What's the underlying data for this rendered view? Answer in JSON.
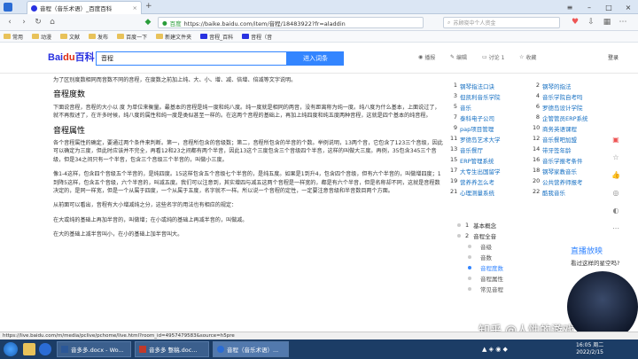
{
  "browser": {
    "tab_title": "音程（音乐术语）_百度百科",
    "new_tab": "+",
    "url": "https://baike.baidu.com/item/音程/18483922?fr=aladdin",
    "secure_label": "百度",
    "search_placeholder": "苏顾晓中个人资金",
    "bookmarks": [
      "常用",
      "动漫",
      "文献",
      "发布",
      "百度一下",
      "新建文件夹",
      "音程_百科",
      "音程（音"
    ]
  },
  "baike": {
    "logo_main": "Bai",
    "logo_mid": "du",
    "logo_suffix": "百科",
    "search_value": "音程",
    "search_button": "进入词条",
    "header_actions": [
      "播报",
      "编辑",
      "讨论 1",
      "收藏",
      "登录"
    ]
  },
  "article": {
    "intro": "为了区别度数相同而音数不同的音程，在度数之前加上纯、大、小、增、减、倍增、倍减等文字说明。",
    "sections": [
      {
        "title": "音程度数",
        "paragraphs": [
          "下面说音程，音程的大小以 度 为单位来衡量。最基本的音程是纯一度和纯八度。纯一度就是相同的两音，没有距离称为纯一度。纯八度为什么基本，上面说过了，就不再叙述了，在许多时候，纯八度的属性和纯一度是类似甚至一样的。在这两个音程的基础上，再加上纯四度和纯五度两种音程，这就是四个基本的纯音程。"
        ]
      },
      {
        "title": "音程属性",
        "paragraphs": [
          "各个音程属性的确定，要通过两个条件来判断。第一，音程所包含的音级数；第二，音程所包含的半音的个数。举例说明，13两个音，它包含了123三个音级，因此可以确定为三度，但此时应该并不完全，再看12和23之间都有两个半音，因此13这个三度包含三个音级四个半音，这样的叫做大三度。再例，35包含345三个音级，但是34之间只有一个半音，包含三个音级三个半音的，叫做小三度。",
          "像1-4这样，包含四个音级五个半音的，是纯四度。15这样包含五个音级七个半音的，是纯五度。如果是1到升4，包含四个音级，但有六个半音的，叫做增四度；1到降5这样，包含五个音级，六个半音的，叫减五度。我们可以注意到，其实增四与减五这两个音程是一样宽的，都是有六个半音，但是名称却不同，这就是音程数决定的，是同一样宽，但是一个从属于四度，一个从属于五度，名字就不一样。所以说一个音程的定性，一定要注意音级和半音数目两个方面。",
          "从前面可以看出，音程有大小增减纯之分，这些名字的用法也有相应的规定：",
          "在大或纯的基础上再加半音的，叫做增；在小或纯的基础上再减半音的，叫做减。",
          "在大的基础上减半音叫小，在小的基础上加半音叫大。"
        ]
      }
    ]
  },
  "sidebar": {
    "related": [
      {
        "n": "1",
        "t": "钢琴指法口诀"
      },
      {
        "n": "2",
        "t": "钢琴的指法"
      },
      {
        "n": "3",
        "t": "但凯利音乐学院"
      },
      {
        "n": "4",
        "t": "音乐学院自考吗"
      },
      {
        "n": "5",
        "t": "音乐"
      },
      {
        "n": "6",
        "t": "罗德岛设计学院"
      },
      {
        "n": "7",
        "t": "泰科电子公司"
      },
      {
        "n": "8",
        "t": "企管管员ERP系统"
      },
      {
        "n": "9",
        "t": "pap项目管理"
      },
      {
        "n": "10",
        "t": "商务英语课程"
      },
      {
        "n": "11",
        "t": "罗德岛艺术大学"
      },
      {
        "n": "12",
        "t": "音乐餐吧加盟"
      },
      {
        "n": "13",
        "t": "音乐餐厅"
      },
      {
        "n": "14",
        "t": "带牙签年龄"
      },
      {
        "n": "15",
        "t": "ERP管理系统"
      },
      {
        "n": "16",
        "t": "音乐学报考条件"
      },
      {
        "n": "17",
        "t": "大专生出国留学"
      },
      {
        "n": "18",
        "t": "钢琴家教音乐"
      },
      {
        "n": "19",
        "t": "营养养怎么考"
      },
      {
        "n": "20",
        "t": "公共营养师报考"
      },
      {
        "n": "21",
        "t": "心理测量系统"
      },
      {
        "n": "22",
        "t": "酷我音乐"
      }
    ],
    "toc": [
      {
        "n": "1",
        "t": "基本概念",
        "level": 1
      },
      {
        "n": "2",
        "t": "音程全音",
        "level": 1
      },
      {
        "n": "",
        "t": "音级",
        "level": 2
      },
      {
        "n": "",
        "t": "音数",
        "level": 2
      },
      {
        "n": "",
        "t": "音程度数",
        "level": 2
      },
      {
        "n": "",
        "t": "音程属性",
        "level": 2
      },
      {
        "n": "",
        "t": "常见音程",
        "level": 2
      }
    ],
    "live_title": "直播放映",
    "live_sub": "看过这样的星空吗?"
  },
  "statusbar": {
    "url": "https://live.baidu.com/m/media/pclive/pchome/live.html?room_id=4957479583&source=h5pre"
  },
  "taskbar": {
    "tasks": [
      "音多多.docx - Wo...",
      "音多多 整稿.doc...",
      "音程（音乐术语）..."
    ],
    "time": "16:05 周二",
    "date": "2022/2/15"
  },
  "watermark": "知乎 @人性的游戏",
  "colors": {
    "accent": "#3385ff",
    "link": "#136ec2",
    "taskbar": "#1c3d66"
  }
}
